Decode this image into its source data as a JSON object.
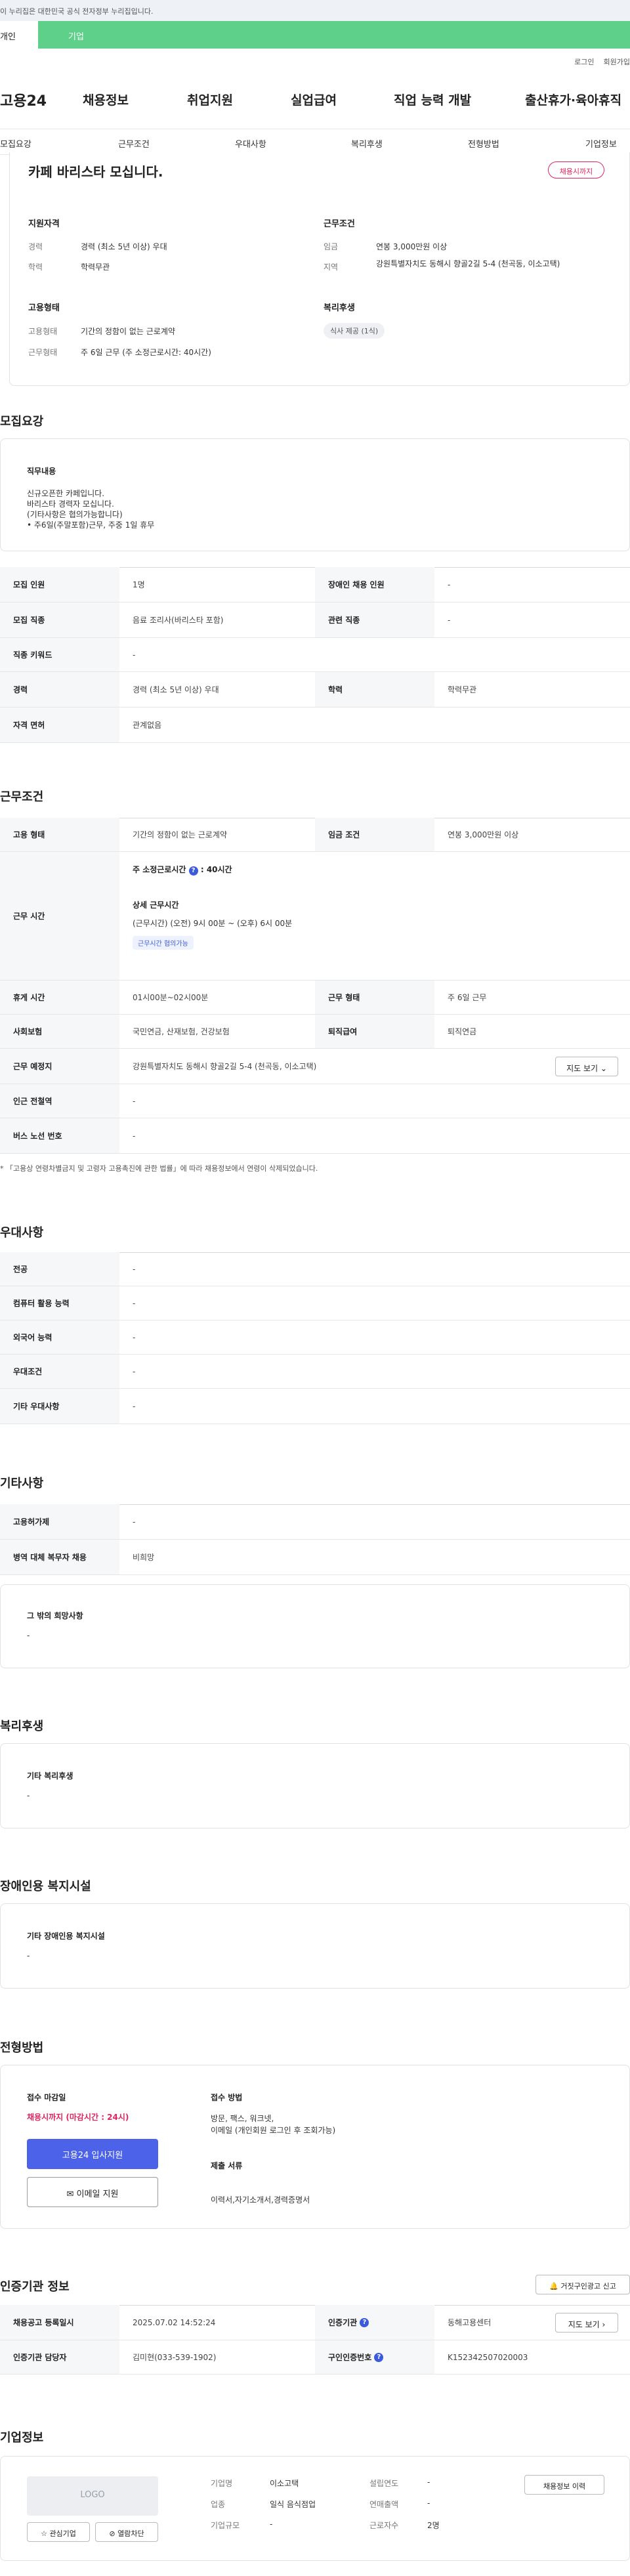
{
  "gov_banner": "이 누리집은 대한민국 공식 전자정부 누리집입니다.",
  "tabs": {
    "personal": "개인",
    "company": "기업"
  },
  "util": {
    "login": "로그인",
    "signup": "회원가입"
  },
  "gnb": {
    "logo": "고용24",
    "items": [
      "채용정보",
      "취업지원",
      "실업급여",
      "직업 능력 개발",
      "출산휴가·육아휴직"
    ]
  },
  "subnav": [
    "모집요강",
    "근무조건",
    "우대사항",
    "복리후생",
    "전형방법",
    "기업정보"
  ],
  "summary": {
    "title": "카페 바리스타 모십니다.",
    "status_badge": "채용시까지",
    "qual_title": "지원자격",
    "qual": [
      {
        "k": "경력",
        "v": "경력 (최소 5년 이상) 우대"
      },
      {
        "k": "학력",
        "v": "학력무관"
      }
    ],
    "cond_title": "근무조건",
    "cond": [
      {
        "k": "임금",
        "v": "연봉 3,000만원 이상"
      },
      {
        "k": "지역",
        "v": "강원특별자치도 동해시 향골2길 5-4 (천곡동, 이소고택)"
      }
    ],
    "emp_title": "고용형태",
    "emp": [
      {
        "k": "고용형태",
        "v": "기간의 정함이 없는 근로계약"
      },
      {
        "k": "근무형태",
        "v": "주 6일 근무 (주 소정근로시간: 40시간)"
      }
    ],
    "welfare_title": "복리후생",
    "welfare_chip": "식사 제공 (1식)"
  },
  "recruit": {
    "title": "모집요강",
    "duty_title": "직무내용",
    "duty_lines": [
      "신규오픈한 카페입니다.",
      "바리스타 경력자 모십니다.",
      "(기타사항은 협의가능합니다)",
      "• 주6일(주말포함)근무, 주중 1일 휴무"
    ],
    "rows": [
      {
        "th": "모집 인원",
        "td": "1명",
        "th2": "장애인 채용 인원",
        "td2": "-"
      },
      {
        "th": "모집 직종",
        "td": "음료 조리사(바리스타 포함)",
        "th2": "관련 직종",
        "td2": "-"
      },
      {
        "th": "직종 키워드",
        "td": "-"
      },
      {
        "th": "경력",
        "td": "경력 (최소 5년 이상) 우대",
        "th2": "학력",
        "td2": "학력무관"
      },
      {
        "th": "자격 면허",
        "td": "관계없음"
      }
    ]
  },
  "work": {
    "title": "근무조건",
    "r1": {
      "th": "고용 형태",
      "td": "기간의 정함이 없는 근로계약",
      "th2": "임금 조건",
      "td2": "연봉 3,000만원 이상"
    },
    "hours": {
      "th": "근무 시간",
      "weekly": "주 소정근로시간",
      "weekly_val": "40시간",
      "detail_title": "상세 근무시간",
      "detail": "(근무시간) (오전) 9시 00분 ~ (오후) 6시 00분",
      "chip": "근무시간 협의가능"
    },
    "r3": {
      "th": "휴게 시간",
      "td": "01시00분~02시00분",
      "th2": "근무 형태",
      "td2": "주 6일 근무"
    },
    "r4": {
      "th": "사회보험",
      "td": "국민연금, 산재보험, 건강보험",
      "th2": "퇴직급여",
      "td2": "퇴직연금"
    },
    "r5": {
      "th": "근무 예정지",
      "td": "강원특별자치도 동해시 향골2길 5-4 (천곡동, 이소고택)",
      "map_btn": "지도 보기"
    },
    "r6": {
      "th": "인근 전철역",
      "td": "-"
    },
    "r7": {
      "th": "버스 노선 번호",
      "td": "-"
    },
    "note": "* 「고용상 연령차별금지 및 고령자 고용촉진에 관한 법률」에 따라 채용정보에서 연령이 삭제되었습니다."
  },
  "pref": {
    "title": "우대사항",
    "rows": [
      {
        "th": "전공",
        "td": "-"
      },
      {
        "th": "컴퓨터 활용 능력",
        "td": "-"
      },
      {
        "th": "외국어 능력",
        "td": "-"
      },
      {
        "th": "우대조건",
        "td": "-"
      },
      {
        "th": "기타 우대사항",
        "td": "-"
      }
    ]
  },
  "etc": {
    "title": "기타사항",
    "rows": [
      {
        "th": "고용허가제",
        "td": "-"
      },
      {
        "th": "병역 대체 복무자 채용",
        "td": "비희망"
      }
    ],
    "box_title": "그 밖의 희망사항",
    "box_val": "-"
  },
  "welfare": {
    "title": "복리후생",
    "box_title": "기타 복리후생",
    "box_val": "-"
  },
  "disab": {
    "title": "장애인용 복지시설",
    "box_title": "기타 장애인용 복지시설",
    "box_val": "-"
  },
  "proc": {
    "title": "전형방법",
    "deadline_title": "접수 마감일",
    "deadline": "채용시까지 (마감시간 : 24시)",
    "apply_btn": "고용24 입사지원",
    "email_btn": "이메일 지원",
    "method_title": "접수 방법",
    "method_lines": [
      "방문, 팩스, 워크넷,",
      "이메일 (개인회원 로그인 후 조회가능)"
    ],
    "docs_title": "제출 서류",
    "docs": "이력서,자기소개서,경력증명서"
  },
  "cert": {
    "title": "인증기관 정보",
    "report_btn": "거짓구인광고 신고",
    "r1": {
      "th": "채용공고 등록일시",
      "td": "2025.07.02 14:52:24",
      "th2": "인증기관",
      "td2": "동해고용센터",
      "btn": "지도 보기"
    },
    "r2": {
      "th": "인증기관 담당자",
      "td": "김미현(033-539-1902)",
      "th2": "구인인증번호",
      "td2": "K152342507020003"
    }
  },
  "company": {
    "title": "기업정보",
    "logo_text": "LOGO",
    "fav_btn": "관심기업",
    "block_btn": "열람차단",
    "fields": [
      {
        "k": "기업명",
        "v": "이소고택"
      },
      {
        "k": "업종",
        "v": "일식 음식점업"
      },
      {
        "k": "기업규모",
        "v": "-"
      },
      {
        "k": "설립연도",
        "v": "-"
      },
      {
        "k": "연매출액",
        "v": "-"
      },
      {
        "k": "근로자수",
        "v": "2명"
      }
    ],
    "history_btn": "채용정보 이력"
  }
}
